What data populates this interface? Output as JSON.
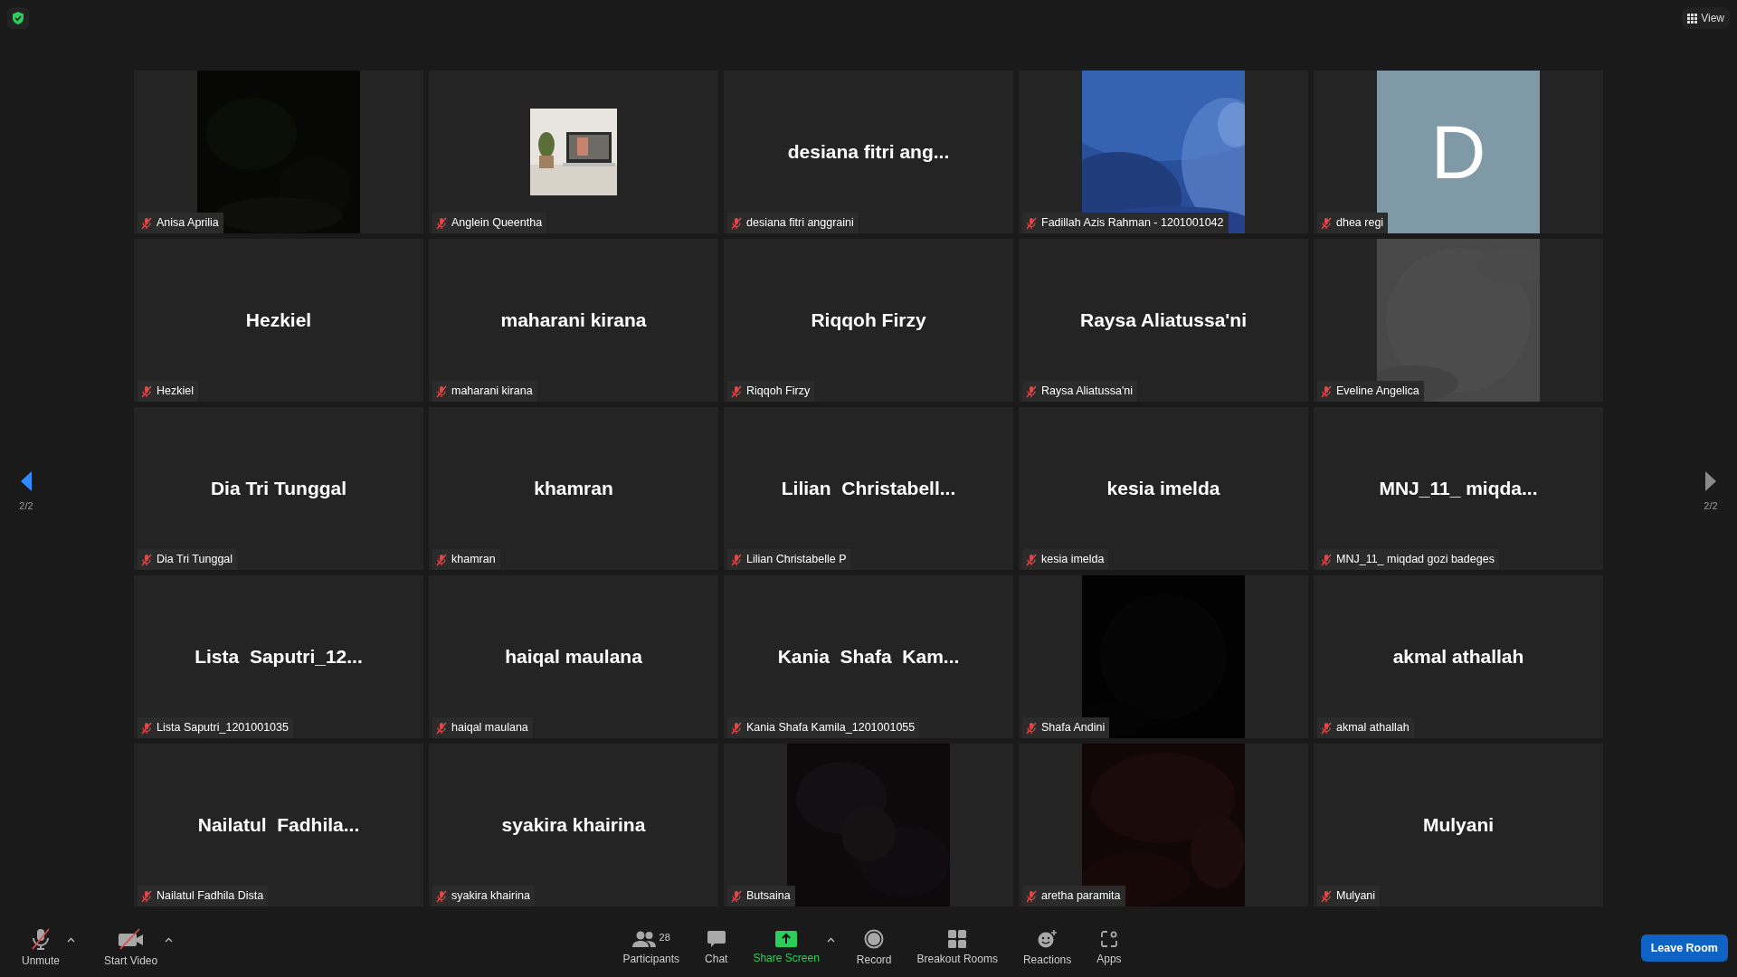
{
  "top_bar": {
    "view_label": "View"
  },
  "pager": {
    "prev": {
      "page": "2/2",
      "disabled": false
    },
    "next": {
      "page": "2/2",
      "disabled": true
    }
  },
  "tiles": [
    {
      "kind": "video",
      "name": "Anisa Aprilia",
      "muted": true
    },
    {
      "name": "Anglein Queentha",
      "muted": true
    },
    {
      "kind": "name",
      "display": "desiana fitri ang...",
      "name": "desiana fitri anggraini",
      "muted": true
    },
    {
      "kind": "video",
      "name": "Fadillah Azis Rahman - 1201001042",
      "muted": true
    },
    {
      "kind": "letter",
      "letter": "D",
      "name": "dhea regi",
      "muted": true
    },
    {
      "kind": "name",
      "display": "Hezkiel",
      "name": "Hezkiel",
      "muted": true
    },
    {
      "kind": "name",
      "display": "maharani kirana",
      "name": "maharani kirana",
      "muted": true
    },
    {
      "kind": "name",
      "display": "Riqqoh Firzy",
      "name": "Riqqoh Firzy",
      "muted": true
    },
    {
      "kind": "name",
      "display": "Raysa Aliatussa'ni",
      "name": "Raysa Aliatussa'ni",
      "muted": true
    },
    {
      "kind": "video",
      "name": "Eveline Angelica",
      "muted": true
    },
    {
      "kind": "name",
      "display": "Dia Tri Tunggal",
      "name": "Dia Tri Tunggal",
      "muted": true
    },
    {
      "kind": "name",
      "display": "khamran",
      "name": "khamran",
      "muted": true
    },
    {
      "kind": "name",
      "display": "Lilian  Christabell...",
      "name": "Lilian Christabelle P",
      "muted": true
    },
    {
      "kind": "name",
      "display": "kesia imelda",
      "name": "kesia imelda",
      "muted": true
    },
    {
      "kind": "name",
      "display": "MNJ_11_ miqda...",
      "name": "MNJ_11_ miqdad gozi badeges",
      "muted": true
    },
    {
      "kind": "name",
      "display": "Lista  Saputri_12...",
      "name": "Lista Saputri_1201001035",
      "muted": true
    },
    {
      "kind": "name",
      "display": "haiqal maulana",
      "name": "haiqal maulana",
      "muted": true
    },
    {
      "kind": "name",
      "display": "Kania  Shafa  Kam...",
      "name": "Kania Shafa Kamila_1201001055",
      "muted": true
    },
    {
      "kind": "video",
      "name": "Shafa Andini",
      "muted": true
    },
    {
      "kind": "name",
      "display": "akmal athallah",
      "name": "akmal athallah",
      "muted": true
    },
    {
      "kind": "name",
      "display": "Nailatul  Fadhila...",
      "name": "Nailatul Fadhila Dista",
      "muted": true
    },
    {
      "kind": "name",
      "display": "syakira khairina",
      "name": "syakira khairina",
      "muted": true
    },
    {
      "kind": "video",
      "name": "Butsaina",
      "muted": true
    },
    {
      "kind": "video",
      "name": "aretha paramita",
      "muted": true
    },
    {
      "kind": "name",
      "display": "Mulyani",
      "name": "Mulyani",
      "muted": true
    }
  ],
  "toolbar": {
    "left": [
      {
        "kind": "mic",
        "label": "Unmute",
        "has_menu": true
      },
      {
        "kind": "video",
        "label": "Start Video",
        "has_menu": true
      }
    ],
    "center": [
      {
        "kind": "participants",
        "label": "Participants",
        "count": "28",
        "has_menu": false
      },
      {
        "kind": "chat",
        "label": "Chat",
        "has_menu": false
      },
      {
        "kind": "share",
        "label": "Share Screen",
        "has_menu": true
      },
      {
        "kind": "record",
        "label": "Record",
        "has_menu": false
      },
      {
        "kind": "breakout",
        "label": "Breakout Rooms",
        "has_menu": false
      },
      {
        "kind": "reactions",
        "label": "Reactions",
        "has_menu": false
      },
      {
        "kind": "apps",
        "label": "Apps",
        "has_menu": false
      }
    ],
    "leave_label": "Leave Room"
  }
}
